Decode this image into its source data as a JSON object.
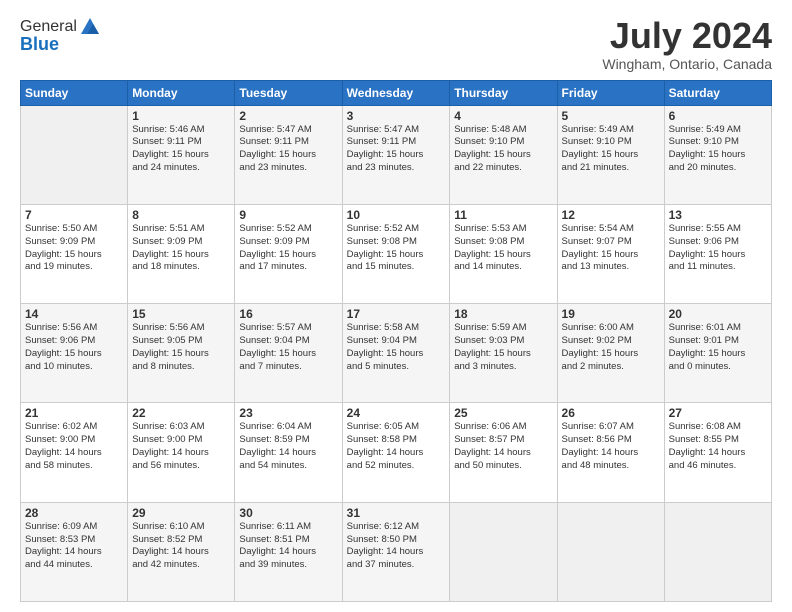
{
  "header": {
    "logo_general": "General",
    "logo_blue": "Blue",
    "month_title": "July 2024",
    "location": "Wingham, Ontario, Canada"
  },
  "calendar": {
    "days_of_week": [
      "Sunday",
      "Monday",
      "Tuesday",
      "Wednesday",
      "Thursday",
      "Friday",
      "Saturday"
    ],
    "weeks": [
      [
        {
          "day": "",
          "info": ""
        },
        {
          "day": "1",
          "info": "Sunrise: 5:46 AM\nSunset: 9:11 PM\nDaylight: 15 hours\nand 24 minutes."
        },
        {
          "day": "2",
          "info": "Sunrise: 5:47 AM\nSunset: 9:11 PM\nDaylight: 15 hours\nand 23 minutes."
        },
        {
          "day": "3",
          "info": "Sunrise: 5:47 AM\nSunset: 9:11 PM\nDaylight: 15 hours\nand 23 minutes."
        },
        {
          "day": "4",
          "info": "Sunrise: 5:48 AM\nSunset: 9:10 PM\nDaylight: 15 hours\nand 22 minutes."
        },
        {
          "day": "5",
          "info": "Sunrise: 5:49 AM\nSunset: 9:10 PM\nDaylight: 15 hours\nand 21 minutes."
        },
        {
          "day": "6",
          "info": "Sunrise: 5:49 AM\nSunset: 9:10 PM\nDaylight: 15 hours\nand 20 minutes."
        }
      ],
      [
        {
          "day": "7",
          "info": "Sunrise: 5:50 AM\nSunset: 9:09 PM\nDaylight: 15 hours\nand 19 minutes."
        },
        {
          "day": "8",
          "info": "Sunrise: 5:51 AM\nSunset: 9:09 PM\nDaylight: 15 hours\nand 18 minutes."
        },
        {
          "day": "9",
          "info": "Sunrise: 5:52 AM\nSunset: 9:09 PM\nDaylight: 15 hours\nand 17 minutes."
        },
        {
          "day": "10",
          "info": "Sunrise: 5:52 AM\nSunset: 9:08 PM\nDaylight: 15 hours\nand 15 minutes."
        },
        {
          "day": "11",
          "info": "Sunrise: 5:53 AM\nSunset: 9:08 PM\nDaylight: 15 hours\nand 14 minutes."
        },
        {
          "day": "12",
          "info": "Sunrise: 5:54 AM\nSunset: 9:07 PM\nDaylight: 15 hours\nand 13 minutes."
        },
        {
          "day": "13",
          "info": "Sunrise: 5:55 AM\nSunset: 9:06 PM\nDaylight: 15 hours\nand 11 minutes."
        }
      ],
      [
        {
          "day": "14",
          "info": "Sunrise: 5:56 AM\nSunset: 9:06 PM\nDaylight: 15 hours\nand 10 minutes."
        },
        {
          "day": "15",
          "info": "Sunrise: 5:56 AM\nSunset: 9:05 PM\nDaylight: 15 hours\nand 8 minutes."
        },
        {
          "day": "16",
          "info": "Sunrise: 5:57 AM\nSunset: 9:04 PM\nDaylight: 15 hours\nand 7 minutes."
        },
        {
          "day": "17",
          "info": "Sunrise: 5:58 AM\nSunset: 9:04 PM\nDaylight: 15 hours\nand 5 minutes."
        },
        {
          "day": "18",
          "info": "Sunrise: 5:59 AM\nSunset: 9:03 PM\nDaylight: 15 hours\nand 3 minutes."
        },
        {
          "day": "19",
          "info": "Sunrise: 6:00 AM\nSunset: 9:02 PM\nDaylight: 15 hours\nand 2 minutes."
        },
        {
          "day": "20",
          "info": "Sunrise: 6:01 AM\nSunset: 9:01 PM\nDaylight: 15 hours\nand 0 minutes."
        }
      ],
      [
        {
          "day": "21",
          "info": "Sunrise: 6:02 AM\nSunset: 9:00 PM\nDaylight: 14 hours\nand 58 minutes."
        },
        {
          "day": "22",
          "info": "Sunrise: 6:03 AM\nSunset: 9:00 PM\nDaylight: 14 hours\nand 56 minutes."
        },
        {
          "day": "23",
          "info": "Sunrise: 6:04 AM\nSunset: 8:59 PM\nDaylight: 14 hours\nand 54 minutes."
        },
        {
          "day": "24",
          "info": "Sunrise: 6:05 AM\nSunset: 8:58 PM\nDaylight: 14 hours\nand 52 minutes."
        },
        {
          "day": "25",
          "info": "Sunrise: 6:06 AM\nSunset: 8:57 PM\nDaylight: 14 hours\nand 50 minutes."
        },
        {
          "day": "26",
          "info": "Sunrise: 6:07 AM\nSunset: 8:56 PM\nDaylight: 14 hours\nand 48 minutes."
        },
        {
          "day": "27",
          "info": "Sunrise: 6:08 AM\nSunset: 8:55 PM\nDaylight: 14 hours\nand 46 minutes."
        }
      ],
      [
        {
          "day": "28",
          "info": "Sunrise: 6:09 AM\nSunset: 8:53 PM\nDaylight: 14 hours\nand 44 minutes."
        },
        {
          "day": "29",
          "info": "Sunrise: 6:10 AM\nSunset: 8:52 PM\nDaylight: 14 hours\nand 42 minutes."
        },
        {
          "day": "30",
          "info": "Sunrise: 6:11 AM\nSunset: 8:51 PM\nDaylight: 14 hours\nand 39 minutes."
        },
        {
          "day": "31",
          "info": "Sunrise: 6:12 AM\nSunset: 8:50 PM\nDaylight: 14 hours\nand 37 minutes."
        },
        {
          "day": "",
          "info": ""
        },
        {
          "day": "",
          "info": ""
        },
        {
          "day": "",
          "info": ""
        }
      ]
    ]
  }
}
